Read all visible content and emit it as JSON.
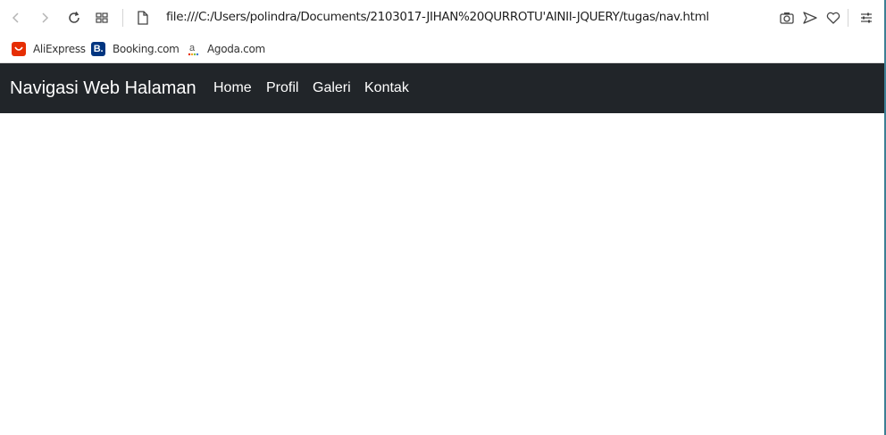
{
  "browser": {
    "url": "file:///C:/Users/polindra/Documents/2103017-JIHAN%20QURROTU'AINII-JQUERY/tugas/nav.html",
    "icons": [
      "back-icon",
      "forward-icon",
      "reload-icon",
      "tabs-grid-icon",
      "page-icon",
      "camera-icon",
      "send-icon",
      "heart-icon",
      "settings-icon"
    ]
  },
  "bookmarks": [
    {
      "label": "AliExpress",
      "icon": "aliexpress-icon",
      "color": "#e62e04"
    },
    {
      "label": "Booking.com",
      "icon": "booking-icon",
      "color": "#003580"
    },
    {
      "label": "Agoda.com",
      "icon": "agoda-icon",
      "color": "#5c5c5c"
    }
  ],
  "navbar": {
    "brand": "Navigasi Web Halaman",
    "links": [
      "Home",
      "Profil",
      "Galeri",
      "Kontak"
    ],
    "background": "#212529"
  }
}
